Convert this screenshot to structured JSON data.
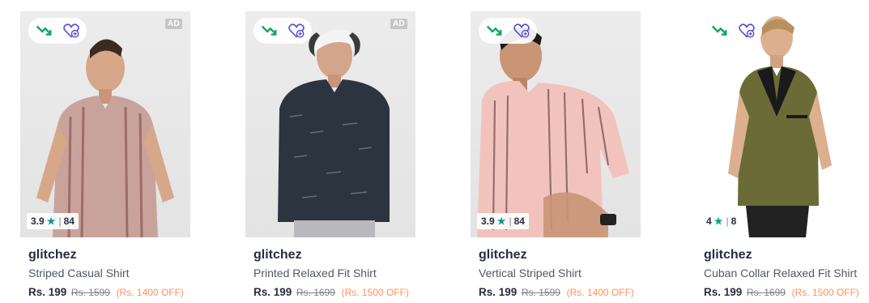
{
  "products": [
    {
      "brand": "glitchez",
      "name": "Striped Casual Shirt",
      "price": "Rs. 199",
      "mrp": "Rs. 1599",
      "discount": "(Rs. 1400 OFF)",
      "rating": "3.9",
      "rating_count": "84",
      "ad": "AD",
      "shirt_color": "#c9a39b",
      "stripe_color": "#8e5b57"
    },
    {
      "brand": "glitchez",
      "name": "Printed Relaxed Fit Shirt",
      "price": "Rs. 199",
      "mrp": "Rs. 1699",
      "discount": "(Rs. 1500 OFF)",
      "rating": "",
      "rating_count": "",
      "ad": "AD",
      "shirt_color": "#2c3440",
      "stripe_color": "#8a93a1"
    },
    {
      "brand": "glitchez",
      "name": "Vertical Striped Shirt",
      "price": "Rs. 199",
      "mrp": "Rs. 1599",
      "discount": "(Rs. 1400 OFF)",
      "rating": "3.9",
      "rating_count": "84",
      "ad": "",
      "shirt_color": "#f2c3bd",
      "stripe_color": "#6d4b4b"
    },
    {
      "brand": "glitchez",
      "name": "Cuban Collar Relaxed Fit Shirt",
      "price": "Rs. 199",
      "mrp": "Rs. 1699",
      "discount": "(Rs. 1500 OFF)",
      "rating": "4",
      "rating_count": "8",
      "ad": "",
      "shirt_color": "#6b6b37",
      "stripe_color": "#1a1a1a"
    }
  ],
  "icons": {
    "price_drop": "trending-down-icon",
    "wishlist": "heart-plus-icon",
    "star": "star-icon"
  },
  "colors": {
    "price_drop_green": "#0fa55c",
    "wishlist_purple": "#5a4fcf",
    "discount_orange": "#ff905a",
    "star_teal": "#14958f"
  }
}
